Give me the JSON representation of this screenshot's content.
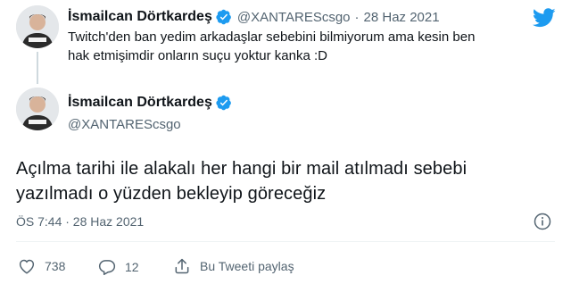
{
  "quoted_tweet": {
    "author_name": "İsmailcan Dörtkardeş",
    "handle": "@XANTAREScsgo",
    "separator": "·",
    "date": "28 Haz 2021",
    "text_line1": "Twitch'den ban yedim arkadaşlar sebebini bilmiyorum ama kesin ben",
    "text_line2": "hak etmişimdir onların suçu yoktur kanka :D"
  },
  "main_tweet": {
    "author_name": "İsmailcan Dörtkardeş",
    "handle": "@XANTAREScsgo",
    "text_line1": "Açılma tarihi ile alakalı her hangi bir mail atılmadı sebebi",
    "text_line2": "yazılmadı o yüzden bekleyip göreceğiz",
    "timestamp": "ÖS 7:44 · 28 Haz 2021"
  },
  "actions": {
    "likes": "738",
    "replies": "12",
    "share_label": "Bu Tweeti paylaş"
  },
  "icons": {
    "brand": "twitter-bird-icon",
    "verified": "verified-badge-icon",
    "info": "info-icon",
    "like": "heart-icon",
    "reply": "reply-icon",
    "share": "share-icon"
  },
  "colors": {
    "brand_blue": "#1d9bf0",
    "text": "#0f1419",
    "secondary": "#536471"
  }
}
